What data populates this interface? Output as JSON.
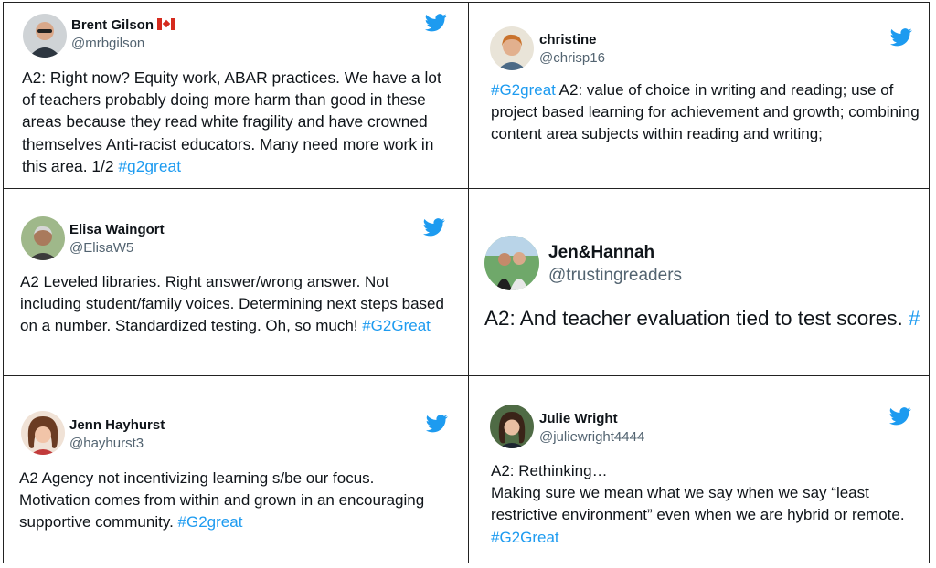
{
  "colors": {
    "twitter_blue": "#1d9bf0",
    "text": "#0f1419",
    "secondary": "#536471"
  },
  "icons": {
    "brand": "twitter-bird-icon"
  },
  "tweets": [
    {
      "name": "Brent Gilson",
      "flag": "canada-flag-emoji",
      "handle": "@mrbgilson",
      "text": "A2: Right now? Equity work, ABAR practices. We have a lot of teachers probably doing more harm than good in these areas because they read white fragility and have crowned themselves Anti-racist educators. Many need more work in this area. 1/2 ",
      "hashtag": "#g2great"
    },
    {
      "name": "christine",
      "handle": "@chrisp16",
      "hashtag": "#G2great",
      "text": " A2: value of choice in writing and reading;  use of project based learning for achievement and growth; combining content area subjects within reading and writing;"
    },
    {
      "name": "Elisa Waingort",
      "handle": "@ElisaW5",
      "text": "A2 Leveled libraries. Right answer/wrong answer. Not including student/family voices. Determining next steps based on a number. Standardized testing. Oh, so much! ",
      "hashtag": "#G2Great"
    },
    {
      "name": "Jen&Hannah",
      "handle": "@trustingreaders",
      "text": "A2: And teacher evaluation tied to test scores. ",
      "hashtag": "#"
    },
    {
      "name": "Jenn Hayhurst",
      "handle": "@hayhurst3",
      "text": "A2 Agency not incentivizing learning s/be our focus. Motivation comes from within and grown in an encouraging supportive community. ",
      "hashtag": "#G2great"
    },
    {
      "name": "Julie Wright",
      "handle": "@juliewright4444",
      "text_line1": "A2: Rethinking…",
      "text": "Making sure we mean what we say when we say “least restrictive environment” even when we are hybrid or remote.  ",
      "hashtag": "#G2Great"
    }
  ]
}
